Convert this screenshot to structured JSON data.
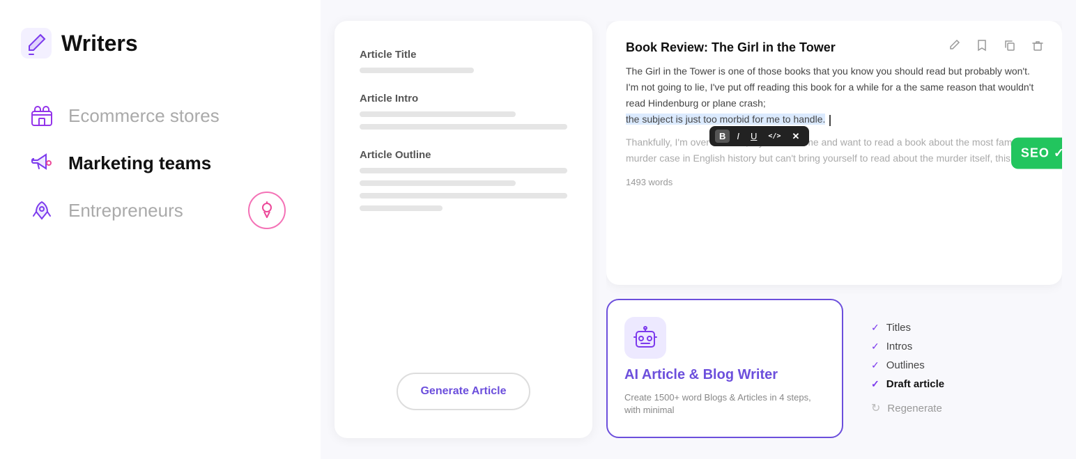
{
  "sidebar": {
    "logo": {
      "text": "Writers",
      "icon": "pen-icon"
    },
    "items": [
      {
        "id": "ecommerce",
        "label": "Ecommerce stores",
        "icon": "store-icon",
        "active": false
      },
      {
        "id": "marketing",
        "label": "Marketing teams",
        "icon": "megaphone-icon",
        "active": true
      },
      {
        "id": "entrepreneurs",
        "label": "Entrepreneurs",
        "icon": "rocket-icon",
        "active": false,
        "badge": "lightbulb-icon"
      }
    ]
  },
  "articleForm": {
    "titleLabel": "Article Title",
    "introLabel": "Article Intro",
    "outlineLabel": "Article Outline",
    "generateBtn": "Generate Article"
  },
  "articleCard": {
    "title": "Book Review: The Girl in the Tower",
    "body1": "The Girl in the Tower is one of those books that you know you should read but probably won't. I'm not going to lie, I've put off reading this book for a while for a the same reason that wouldn't read",
    "body1_middle": " Hindenburg or plane crash;",
    "body_highlighted": "the subject is just too morbid for me to handle.",
    "body2": "Thankfully, I'm over that. So, if you're like me and want to read a book about the most famous murder case in English history but can't bring yourself to read about the murder itself, this is",
    "wordCount": "1493 words",
    "formatToolbar": {
      "bold": "B",
      "italic": "I",
      "underline": "U",
      "code": "</>",
      "link": "✕"
    },
    "seoBadge": "SEO ✓"
  },
  "aiWriterCard": {
    "title": "AI Article & Blog Writer",
    "subtitle": "Create 1500+ word Blogs & Articles in 4 steps, with minimal",
    "iconAlt": "ai-writer-icon"
  },
  "checklist": {
    "items": [
      {
        "label": "Titles",
        "checked": true,
        "bold": false
      },
      {
        "label": "Intros",
        "checked": true,
        "bold": false
      },
      {
        "label": "Outlines",
        "checked": true,
        "bold": false
      },
      {
        "label": "Draft article",
        "checked": true,
        "bold": true
      }
    ],
    "regenerate": "Regenerate"
  }
}
